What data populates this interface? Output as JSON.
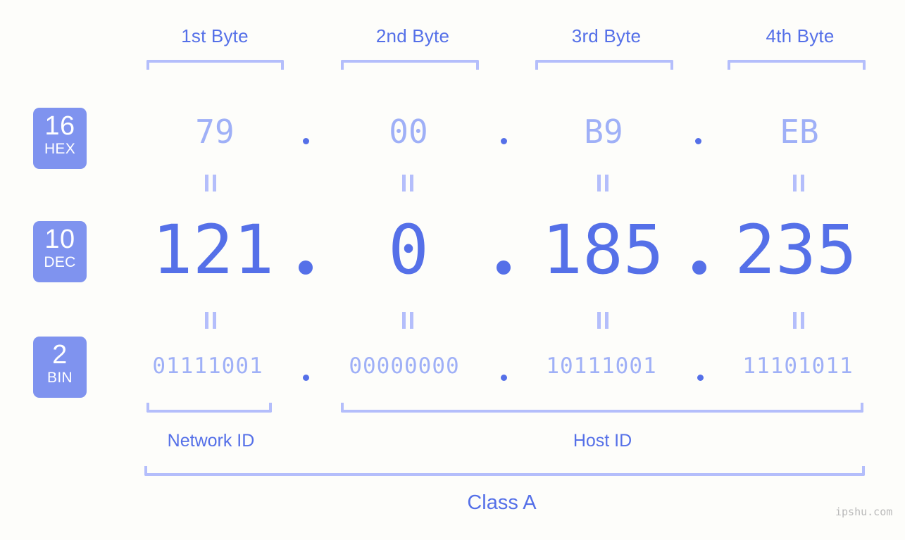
{
  "page": {
    "background_color": "#fdfdfa",
    "accent_color": "#5570e8",
    "accent_light_color": "#9fb0f7",
    "bracket_color": "#b4befb",
    "badge_color": "#7f93ef",
    "watermark": "ipshu.com"
  },
  "byte_headers": [
    {
      "label": "1st Byte"
    },
    {
      "label": "2nd Byte"
    },
    {
      "label": "3rd Byte"
    },
    {
      "label": "4th Byte"
    }
  ],
  "radix_badges": [
    {
      "number": "16",
      "name": "HEX"
    },
    {
      "number": "10",
      "name": "DEC"
    },
    {
      "number": "2",
      "name": "BIN"
    }
  ],
  "rows": {
    "hex": {
      "radix": "16",
      "radix_name": "HEX",
      "values": [
        "79",
        "00",
        "B9",
        "EB"
      ],
      "separator": "."
    },
    "dec": {
      "radix": "10",
      "radix_name": "DEC",
      "values": [
        "121",
        "0",
        "185",
        "235"
      ],
      "separator": "."
    },
    "bin": {
      "radix": "2",
      "radix_name": "BIN",
      "values": [
        "01111001",
        "00000000",
        "10111001",
        "11101011"
      ],
      "separator": "."
    }
  },
  "equals_marks": {
    "symbol": "=",
    "hex_to_dec_count": 4,
    "dec_to_bin_count": 4
  },
  "sections": [
    {
      "label": "Network ID"
    },
    {
      "label": "Host ID"
    }
  ],
  "class": {
    "label": "Class A"
  }
}
